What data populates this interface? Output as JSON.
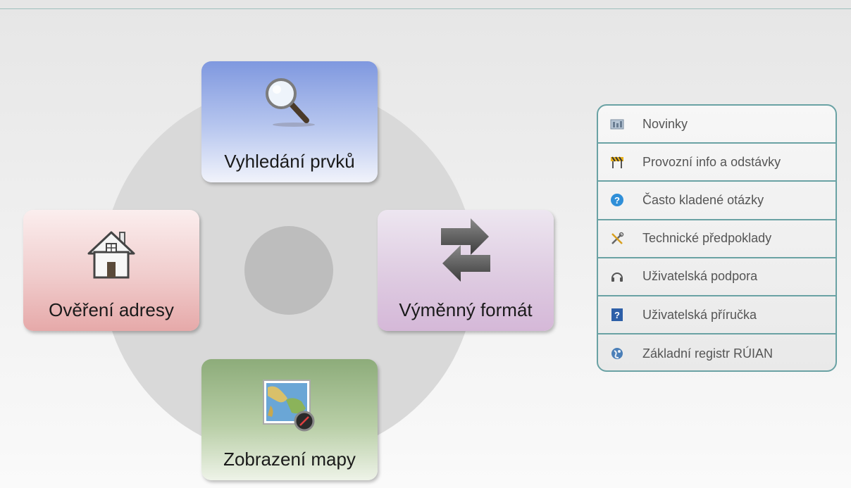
{
  "tiles": {
    "search": {
      "label": "Vyhledání prvků",
      "icon": "magnifier-icon"
    },
    "address": {
      "label": "Ověření adresy",
      "icon": "house-icon"
    },
    "exchange": {
      "label": "Výměnný formát",
      "icon": "exchange-arrows-icon"
    },
    "map": {
      "label": "Zobrazení mapy",
      "icon": "world-map-icon"
    }
  },
  "links": [
    {
      "label": "Novinky",
      "icon": "news-icon"
    },
    {
      "label": "Provozní info a odstávky",
      "icon": "roadblock-icon"
    },
    {
      "label": "Často kladené otázky",
      "icon": "question-icon"
    },
    {
      "label": "Technické předpoklady",
      "icon": "tools-icon"
    },
    {
      "label": "Uživatelská podpora",
      "icon": "headset-icon"
    },
    {
      "label": "Uživatelská příručka",
      "icon": "manual-icon"
    },
    {
      "label": "Základní registr RÚIAN",
      "icon": "registry-icon"
    }
  ],
  "colors": {
    "accent_border": "#6aa2a4"
  }
}
